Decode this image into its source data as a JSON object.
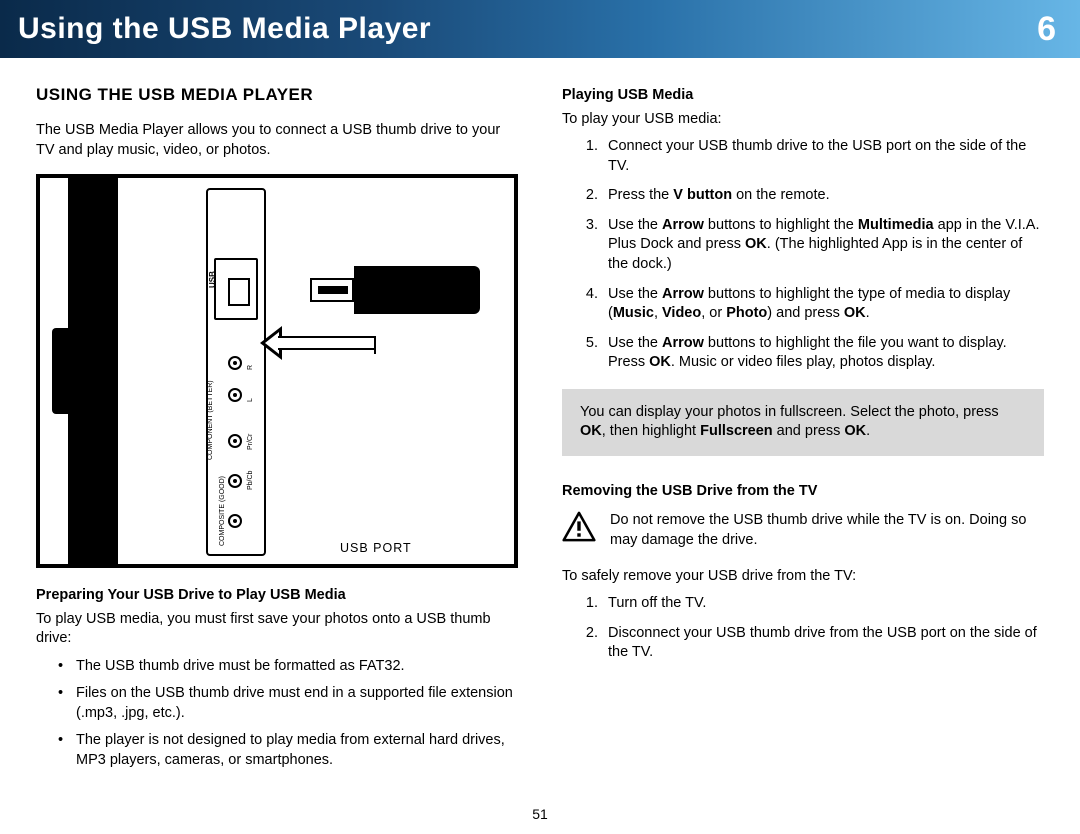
{
  "chapter": {
    "title": "Using the USB Media Player",
    "number": "6"
  },
  "left": {
    "heading": "USING THE USB MEDIA PLAYER",
    "intro": "The USB Media Player allows you to connect a USB thumb drive to your TV and play music, video, or photos.",
    "caption": "USB PORT",
    "prep_head": "Preparing Your USB Drive to Play USB Media",
    "prep_intro": "To play USB media, you must first save your photos onto a USB thumb drive:",
    "bullets": [
      "The USB thumb drive must be formatted as FAT32.",
      "Files on the USB thumb drive must end in a supported file extension (.mp3, .jpg, etc.).",
      "The player is not designed to play media from external hard drives, MP3 players, cameras, or smartphones."
    ]
  },
  "right": {
    "play_head": "Playing USB Media",
    "play_intro": "To play your USB media:",
    "steps": [
      "Connect your USB thumb drive to the USB port on the side of the TV.",
      "Press the <b>V button</b> on the remote.",
      "Use the <b>Arrow</b> buttons to highlight the <b>Multimedia</b> app in the V.I.A. Plus Dock and press <b>OK</b>. (The highlighted App is in the center of the dock.)",
      "Use the <b>Arrow</b> buttons to highlight the type of media to display (<b>Music</b>, <b>Video</b>, or <b>Photo</b>) and press <b>OK</b>.",
      "Use the <b>Arrow</b> buttons to highlight the file you want to display. Press <b>OK</b>. Music or video files play, photos display."
    ],
    "tip": "You can display your photos in fullscreen. Select the photo, press <b>OK</b>, then highlight <b>Fullscreen</b> and press <b>OK</b>.",
    "remove_head": "Removing the USB Drive from the TV",
    "warning": "Do not remove the USB thumb drive while the TV is on. Doing so may damage the drive.",
    "remove_intro": "To safely remove your USB drive from the TV:",
    "remove_steps": [
      "Turn off the TV.",
      "Disconnect your USB thumb drive from the USB port on the side of the TV."
    ]
  },
  "page_number": "51"
}
